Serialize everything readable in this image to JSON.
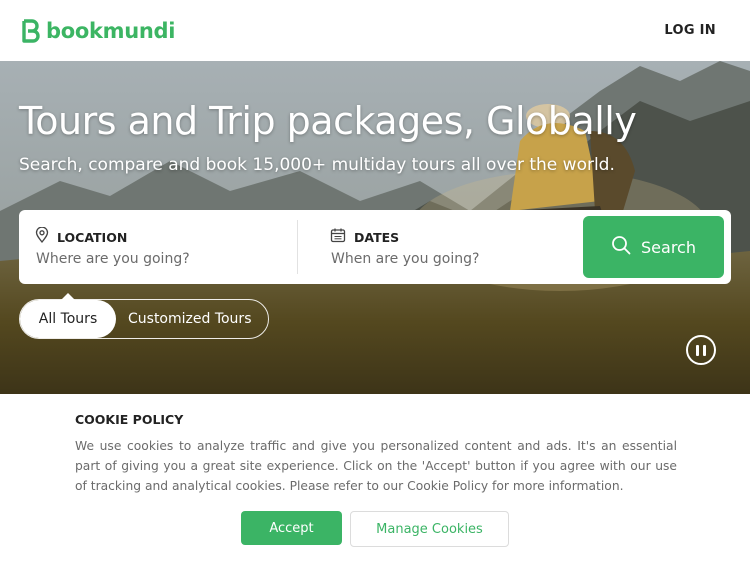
{
  "header": {
    "brand": "bookmundi",
    "login_label": "LOG IN"
  },
  "hero": {
    "title": "Tours and Trip packages, Globally",
    "subtitle": "Search, compare and book 15,000+ multiday tours all over the world."
  },
  "search": {
    "location_label": "LOCATION",
    "location_placeholder": "Where are you going?",
    "dates_label": "DATES",
    "dates_placeholder": "When are you going?",
    "button_label": "Search"
  },
  "tabs": [
    {
      "label": "All Tours",
      "active": true
    },
    {
      "label": "Customized Tours",
      "active": false
    }
  ],
  "cookie": {
    "title": "COOKIE POLICY",
    "text": "We use cookies to analyze traffic and give you personalized content and ads. It's an essential part of giving you a great site experience. Click on the 'Accept' button if you agree with our use of tracking and analytical cookies. Please refer to our Cookie Policy for more information.",
    "accept_label": "Accept",
    "manage_label": "Manage Cookies"
  },
  "colors": {
    "brand_green": "#3bb465",
    "text_dark": "#222222",
    "text_muted": "#6b6b6b"
  },
  "icons": {
    "logo": "bookmundi-b-logo-icon",
    "location": "map-pin-icon",
    "dates": "calendar-icon",
    "search": "search-icon",
    "pause": "pause-icon"
  }
}
